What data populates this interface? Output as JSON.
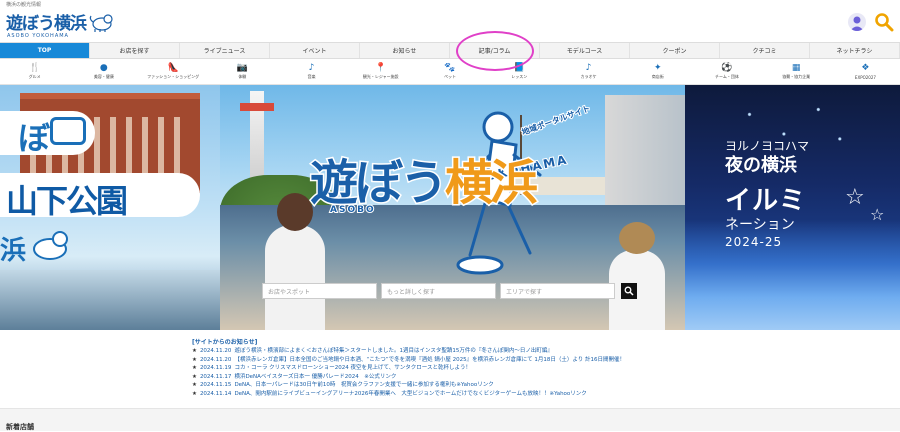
{
  "header": {
    "tagline": "横浜の観光情報",
    "logo_text": "遊ぼう横浜",
    "logo_sub": "ASOBO YOKOHAMA"
  },
  "mainnav": {
    "tabs": [
      {
        "label": "TOP",
        "active": true
      },
      {
        "label": "お店を探す"
      },
      {
        "label": "ライブニュース"
      },
      {
        "label": "イベント"
      },
      {
        "label": "お知らせ"
      },
      {
        "label": "記事/コラム",
        "highlighted": true
      },
      {
        "label": "モデルコース"
      },
      {
        "label": "クーポン"
      },
      {
        "label": "クチコミ"
      },
      {
        "label": "ネットチラシ"
      }
    ]
  },
  "catnav": {
    "items": [
      {
        "label": "グルメ",
        "icon": "fork-knife-icon",
        "glyph": "🍴"
      },
      {
        "label": "美容・健康",
        "icon": "beauty-icon",
        "glyph": "●"
      },
      {
        "label": "ファッション・ショッピング",
        "icon": "heel-shoe-icon",
        "glyph": "👠"
      },
      {
        "label": "体験",
        "icon": "camera-icon",
        "glyph": "📷"
      },
      {
        "label": "音楽",
        "icon": "music-note-icon",
        "glyph": "♪"
      },
      {
        "label": "観光・レジャー施設",
        "icon": "map-pin-icon",
        "glyph": "📍"
      },
      {
        "label": "ペット",
        "icon": "paw-icon",
        "glyph": "🐾"
      },
      {
        "label": "レッスン",
        "icon": "book-icon",
        "glyph": "📘"
      },
      {
        "label": "カラオケ",
        "icon": "music-note-icon",
        "glyph": "♪"
      },
      {
        "label": "商店街",
        "icon": "sparkle-icon",
        "glyph": "✦"
      },
      {
        "label": "チーム・団体",
        "icon": "soccer-ball-icon",
        "glyph": "⚽"
      },
      {
        "label": "協賛・協力企業",
        "icon": "building-icon",
        "glyph": "▦"
      },
      {
        "label": "EXPO2027",
        "icon": "expo-icon",
        "glyph": "❖"
      }
    ]
  },
  "hero": {
    "left_title": "山下公園",
    "left_bo": "ぼ",
    "left_logo": "浜",
    "center_logo_a": "遊ぼう",
    "center_logo_b": "横浜",
    "center_yoko": "YOKOHAMA",
    "center_chiiki": "地域ポータルサイト",
    "center_asobo": "ASOBO",
    "right_sub": "ヨルノヨコハマ",
    "right_line1": "夜の横浜",
    "right_line2": "イルミ",
    "right_line3": "ネーション",
    "right_line4": "2024-25",
    "search": {
      "placeholder1": "お店やスポット",
      "placeholder2": "もっと詳しく探す",
      "placeholder3": "エリアで探す"
    }
  },
  "news": {
    "title": "[サイトからのお知らせ]",
    "items": [
      {
        "date": "2024.11.20",
        "text": "遊ぼう横浜・横濱部によまく＜おさんぽ特集＞スタートしました。1週目はインスタ聖蹟15万件の『冬さんぽ関内〜日ノ出町編』"
      },
      {
        "date": "2024.11.20",
        "text": "【横浜赤レンガ倉庫】日本全国のご当地鍋や日本酒、“こたつ”で冬を満喫『酒処 鍋小屋 2025』を横浜赤レンガ倉庫にて 1月18日（土）より 計16日間開催！"
      },
      {
        "date": "2024.11.19",
        "text": "コカ・コーラ クリスマスドローンショー2024 夜空を見上げて、サンタクロースと乾杯しよう！"
      },
      {
        "date": "2024.11.17",
        "text": "横浜DeNAベイスターズ日本一 優勝パレード2024　※公式リンク"
      },
      {
        "date": "2024.11.15",
        "text": "DeNA、日本一パレードは30日午前10時　祝賀会クラファン支援で一緒に参加する権利も※Yahooリンク"
      },
      {
        "date": "2024.11.14",
        "text": "DeNA、閲内駅前にライブビューイングアリーナ2026年春開業へ　大型ビジョンでホームだけでなくビジターゲームも放映！！※Yahooリンク"
      }
    ]
  },
  "sections": {
    "new_stores_title": "新着店舗"
  }
}
